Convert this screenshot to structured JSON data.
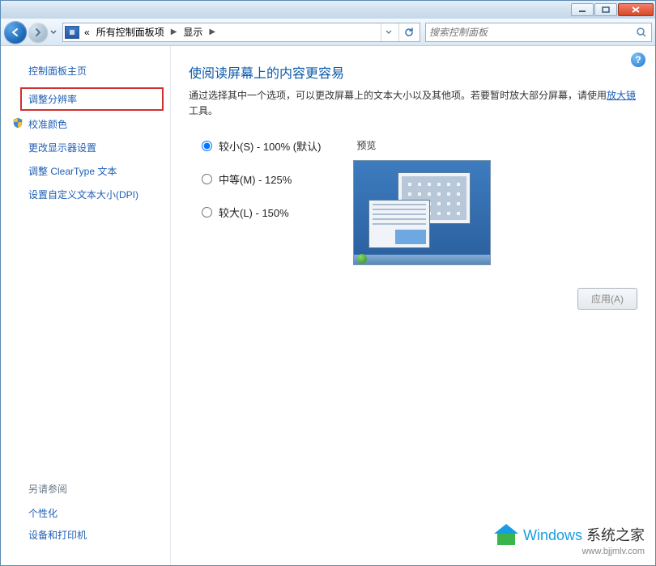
{
  "breadcrumb": {
    "laquo": "«",
    "item1": "所有控制面板项",
    "item2": "显示"
  },
  "search": {
    "placeholder": "搜索控制面板"
  },
  "sidebar": {
    "home": "控制面板主页",
    "links": [
      "调整分辨率",
      "校准颜色",
      "更改显示器设置",
      "调整 ClearType 文本",
      "设置自定义文本大小(DPI)"
    ],
    "see_also_heading": "另请参阅",
    "see_also": [
      "个性化",
      "设备和打印机"
    ]
  },
  "main": {
    "title": "使阅读屏幕上的内容更容易",
    "desc_before": "通过选择其中一个选项，可以更改屏幕上的文本大小以及其他项。若要暂时放大部分屏幕，请使用",
    "desc_link": "放大镜",
    "desc_after": "工具。",
    "options": [
      {
        "label": "较小(S) - 100% (默认)",
        "checked": true
      },
      {
        "label": "中等(M) - 125%",
        "checked": false
      },
      {
        "label": "较大(L) - 150%",
        "checked": false
      }
    ],
    "preview_label": "预览",
    "apply_label": "应用(A)"
  },
  "watermark": {
    "brand_html_prefix": "Windows",
    "brand_html_suffix": "系统之家",
    "url": "www.bjjmlv.com"
  }
}
